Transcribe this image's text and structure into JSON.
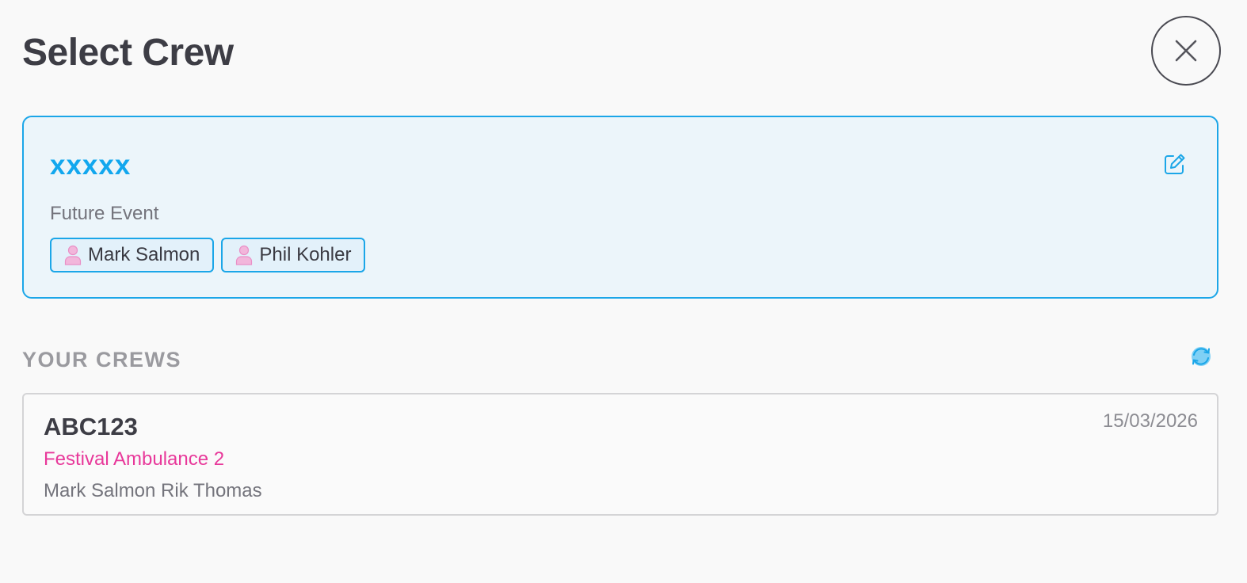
{
  "header": {
    "title": "Select Crew",
    "close_icon": "close-icon"
  },
  "selected_crew": {
    "name": "xxxxx",
    "subtitle": "Future Event",
    "edit_icon": "edit-icon",
    "members": [
      {
        "name": "Mark Salmon",
        "icon": "person-icon"
      },
      {
        "name": "Phil Kohler",
        "icon": "person-icon"
      }
    ],
    "accent_color": "#1ba6e8"
  },
  "your_crews": {
    "heading": "YOUR CREWS",
    "refresh_icon": "refresh-icon",
    "items": [
      {
        "code": "ABC123",
        "vehicle": "Festival Ambulance 2",
        "members": "Mark Salmon Rik Thomas",
        "date": "15/03/2026"
      }
    ]
  },
  "colors": {
    "accent_blue": "#12a7ee",
    "vehicle_pink": "#e8389a",
    "person_icon_pink": "#e98fc6"
  }
}
